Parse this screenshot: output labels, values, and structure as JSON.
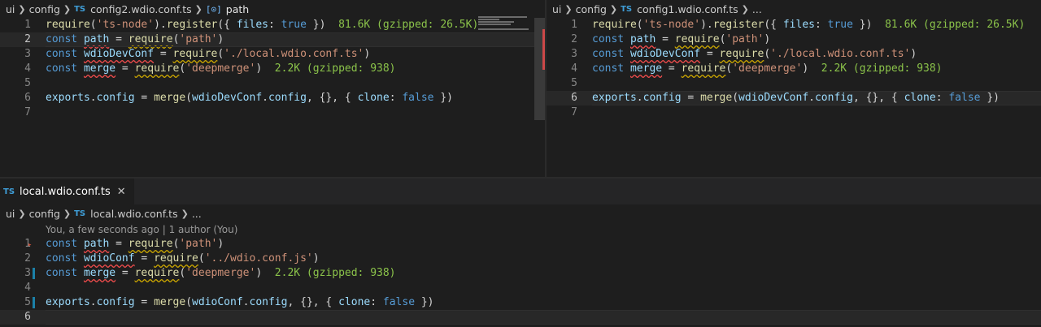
{
  "left_editor": {
    "breadcrumb": [
      "ui",
      "config",
      "config2.wdio.conf.ts",
      "path"
    ],
    "lines": [
      {
        "n": "1",
        "tokens": [
          [
            "fn",
            "require"
          ],
          [
            "pn",
            "("
          ],
          [
            "str",
            "'ts-node'"
          ],
          [
            "pn",
            ")."
          ],
          [
            "fn",
            "register"
          ],
          [
            "pn",
            "({ "
          ],
          [
            "var",
            "files"
          ],
          [
            "pn",
            ": "
          ],
          [
            "bool",
            "true"
          ],
          [
            "pn",
            " })  "
          ],
          [
            "hint",
            "81.6K (gzipped: 26.5K)"
          ]
        ]
      },
      {
        "n": "2",
        "active": true,
        "tokens": [
          [
            "kw",
            "const "
          ],
          [
            "var",
            "path"
          ],
          [
            "pn",
            " = "
          ],
          [
            "fn",
            "require"
          ],
          [
            "pn",
            "("
          ],
          [
            "str",
            "'path'"
          ],
          [
            "pn",
            ")"
          ]
        ]
      },
      {
        "n": "3",
        "tokens": [
          [
            "kw",
            "const "
          ],
          [
            "var",
            "wdioDevConf"
          ],
          [
            "pn",
            " = "
          ],
          [
            "fn",
            "require"
          ],
          [
            "pn",
            "("
          ],
          [
            "str",
            "'./local.wdio.conf.ts'"
          ],
          [
            "pn",
            ")"
          ]
        ]
      },
      {
        "n": "4",
        "tokens": [
          [
            "kw",
            "const "
          ],
          [
            "var",
            "merge"
          ],
          [
            "pn",
            " = "
          ],
          [
            "fn",
            "require"
          ],
          [
            "pn",
            "("
          ],
          [
            "str",
            "'deepmerge'"
          ],
          [
            "pn",
            ")  "
          ],
          [
            "hint",
            "2.2K (gzipped: 938)"
          ]
        ]
      },
      {
        "n": "5",
        "tokens": []
      },
      {
        "n": "6",
        "tokens": [
          [
            "var",
            "exports"
          ],
          [
            "pn",
            "."
          ],
          [
            "var",
            "config"
          ],
          [
            "pn",
            " = "
          ],
          [
            "fn",
            "merge"
          ],
          [
            "pn",
            "("
          ],
          [
            "var",
            "wdioDevConf"
          ],
          [
            "pn",
            "."
          ],
          [
            "var",
            "config"
          ],
          [
            "pn",
            ", {}, { "
          ],
          [
            "var",
            "clone"
          ],
          [
            "pn",
            ": "
          ],
          [
            "bool",
            "false"
          ],
          [
            "pn",
            " })"
          ]
        ]
      },
      {
        "n": "7",
        "tokens": []
      }
    ]
  },
  "right_editor": {
    "breadcrumb": [
      "ui",
      "config",
      "config1.wdio.conf.ts",
      "..."
    ],
    "lines": [
      {
        "n": "1",
        "tokens": [
          [
            "fn",
            "require"
          ],
          [
            "pn",
            "("
          ],
          [
            "str",
            "'ts-node'"
          ],
          [
            "pn",
            ")."
          ],
          [
            "fn",
            "register"
          ],
          [
            "pn",
            "({ "
          ],
          [
            "var",
            "files"
          ],
          [
            "pn",
            ": "
          ],
          [
            "bool",
            "true"
          ],
          [
            "pn",
            " })  "
          ],
          [
            "hint",
            "81.6K (gzipped: 26.5K)"
          ]
        ]
      },
      {
        "n": "2",
        "tokens": [
          [
            "kw",
            "const "
          ],
          [
            "var",
            "path"
          ],
          [
            "pn",
            " = "
          ],
          [
            "fn",
            "require"
          ],
          [
            "pn",
            "("
          ],
          [
            "str",
            "'path'"
          ],
          [
            "pn",
            ")"
          ]
        ]
      },
      {
        "n": "3",
        "tokens": [
          [
            "kw",
            "const "
          ],
          [
            "var",
            "wdioDevConf"
          ],
          [
            "pn",
            " = "
          ],
          [
            "fn",
            "require"
          ],
          [
            "pn",
            "("
          ],
          [
            "str",
            "'./local.wdio.conf.ts'"
          ],
          [
            "pn",
            ")"
          ]
        ]
      },
      {
        "n": "4",
        "tokens": [
          [
            "kw",
            "const "
          ],
          [
            "var",
            "merge"
          ],
          [
            "pn",
            " = "
          ],
          [
            "fn",
            "require"
          ],
          [
            "pn",
            "("
          ],
          [
            "str",
            "'deepmerge'"
          ],
          [
            "pn",
            ")  "
          ],
          [
            "hint",
            "2.2K (gzipped: 938)"
          ]
        ]
      },
      {
        "n": "5",
        "tokens": []
      },
      {
        "n": "6",
        "active": true,
        "tokens": [
          [
            "var",
            "exports"
          ],
          [
            "pn",
            "."
          ],
          [
            "var",
            "config"
          ],
          [
            "pn",
            " = "
          ],
          [
            "fn",
            "merge"
          ],
          [
            "pn",
            "("
          ],
          [
            "var",
            "wdioDevConf"
          ],
          [
            "pn",
            "."
          ],
          [
            "var",
            "config"
          ],
          [
            "pn",
            ", {}, { "
          ],
          [
            "var",
            "clone"
          ],
          [
            "pn",
            ": "
          ],
          [
            "bool",
            "false"
          ],
          [
            "pn",
            " })"
          ]
        ]
      },
      {
        "n": "7",
        "tokens": []
      }
    ]
  },
  "bottom_editor": {
    "tab": {
      "label": "local.wdio.conf.ts",
      "close": "✕"
    },
    "breadcrumb": [
      "ui",
      "config",
      "local.wdio.conf.ts",
      "..."
    ],
    "blame": "You, a few seconds ago | 1 author (You)",
    "lines": [
      {
        "n": "1",
        "tokens": [
          [
            "kw",
            "const "
          ],
          [
            "var",
            "path"
          ],
          [
            "pn",
            " = "
          ],
          [
            "fn",
            "require"
          ],
          [
            "pn",
            "("
          ],
          [
            "str",
            "'path'"
          ],
          [
            "pn",
            ")"
          ]
        ]
      },
      {
        "n": "2",
        "tokens": [
          [
            "kw",
            "const "
          ],
          [
            "var",
            "wdioConf"
          ],
          [
            "pn",
            " = "
          ],
          [
            "fn",
            "require"
          ],
          [
            "pn",
            "("
          ],
          [
            "str",
            "'../wdio.conf.js'"
          ],
          [
            "pn",
            ")"
          ]
        ]
      },
      {
        "n": "3",
        "tokens": [
          [
            "kw",
            "const "
          ],
          [
            "var",
            "merge"
          ],
          [
            "pn",
            " = "
          ],
          [
            "fn",
            "require"
          ],
          [
            "pn",
            "("
          ],
          [
            "str",
            "'deepmerge'"
          ],
          [
            "pn",
            ")  "
          ],
          [
            "hint",
            "2.2K (gzipped: 938)"
          ]
        ]
      },
      {
        "n": "4",
        "tokens": []
      },
      {
        "n": "5",
        "tokens": [
          [
            "var",
            "exports"
          ],
          [
            "pn",
            "."
          ],
          [
            "var",
            "config"
          ],
          [
            "pn",
            " = "
          ],
          [
            "fn",
            "merge"
          ],
          [
            "pn",
            "("
          ],
          [
            "var",
            "wdioConf"
          ],
          [
            "pn",
            "."
          ],
          [
            "var",
            "config"
          ],
          [
            "pn",
            ", {}, { "
          ],
          [
            "var",
            "clone"
          ],
          [
            "pn",
            ": "
          ],
          [
            "bool",
            "false"
          ],
          [
            "pn",
            " })"
          ]
        ]
      },
      {
        "n": "6",
        "active": true,
        "tokens": []
      }
    ]
  },
  "colors": {
    "background": "#1e1e1e",
    "keyword": "#569cd6",
    "function": "#dcdcaa",
    "string": "#ce9178",
    "variable": "#9cdcfe",
    "hint": "#8bc34a",
    "git_modified": "#1b81a8",
    "error": "#f14c4c"
  }
}
